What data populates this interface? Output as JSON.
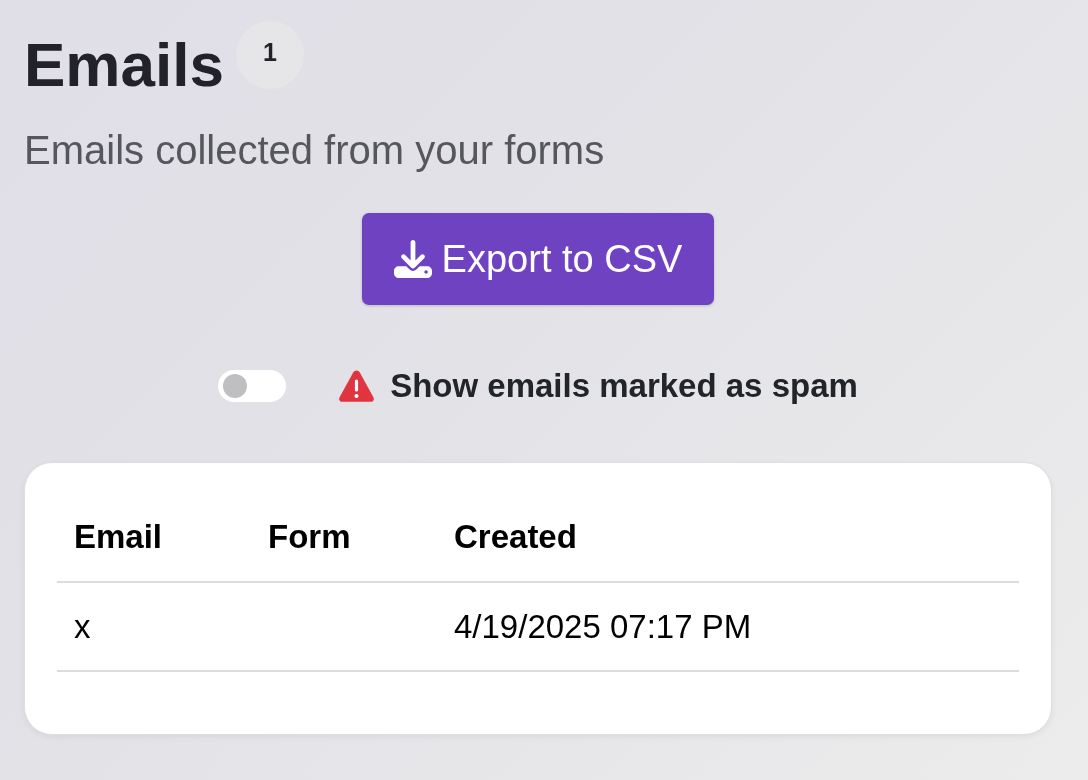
{
  "header": {
    "title": "Emails",
    "count": "1",
    "subtitle": "Emails collected from your forms"
  },
  "export_button": {
    "label": "Export to CSV"
  },
  "spam_toggle": {
    "on": false,
    "label": "Show emails marked as spam"
  },
  "table": {
    "columns": [
      "Email",
      "Form",
      "Created"
    ],
    "rows": [
      {
        "email": "x",
        "created": "4/19/2025 07:17 PM"
      }
    ]
  }
}
